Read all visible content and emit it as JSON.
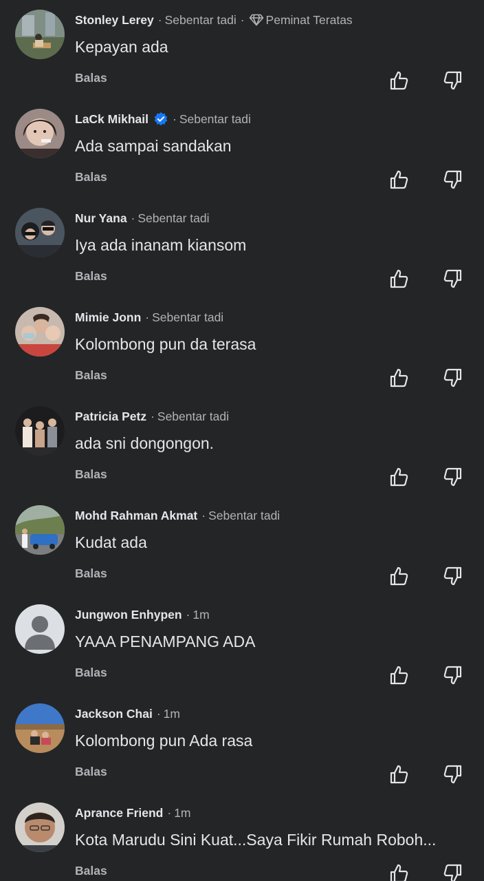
{
  "reply_label": "Balas",
  "colors": {
    "background": "#242526",
    "primary_text": "#e4e6eb",
    "secondary_text": "#b0b3b8",
    "verified": "#1877f2"
  },
  "comments": [
    {
      "name": "Stonley Lerey",
      "time": "Sebentar tadi",
      "badge": "Peminat Teratas",
      "badge_icon": "diamond-icon",
      "text": "Kepayan ada",
      "verified": false,
      "avatar": "photo"
    },
    {
      "name": "LaCk Mikhail",
      "time": "Sebentar tadi",
      "text": "Ada sampai sandakan",
      "verified": true,
      "avatar": "photo"
    },
    {
      "name": "Nur Yana",
      "time": "Sebentar tadi",
      "text": "Iya ada inanam kiansom",
      "verified": false,
      "avatar": "photo"
    },
    {
      "name": "Mimie Jonn",
      "time": "Sebentar tadi",
      "text": "Kolombong pun da terasa",
      "verified": false,
      "avatar": "photo"
    },
    {
      "name": "Patricia Petz",
      "time": "Sebentar tadi",
      "text": "ada sni dongongon.",
      "verified": false,
      "avatar": "photo"
    },
    {
      "name": "Mohd Rahman Akmat",
      "time": "Sebentar tadi",
      "text": "Kudat ada",
      "verified": false,
      "avatar": "photo"
    },
    {
      "name": "Jungwon Enhypen",
      "time": "1m",
      "text": "YAAA PENAMPANG ADA",
      "verified": false,
      "avatar": "default-avatar-icon"
    },
    {
      "name": "Jackson Chai",
      "time": "1m",
      "text": "Kolombong pun Ada rasa",
      "verified": false,
      "avatar": "photo"
    },
    {
      "name": "Aprance Friend",
      "time": "1m",
      "text": "Kota Marudu Sini Kuat...Saya Fikir Rumah Roboh...",
      "verified": false,
      "avatar": "photo"
    }
  ]
}
